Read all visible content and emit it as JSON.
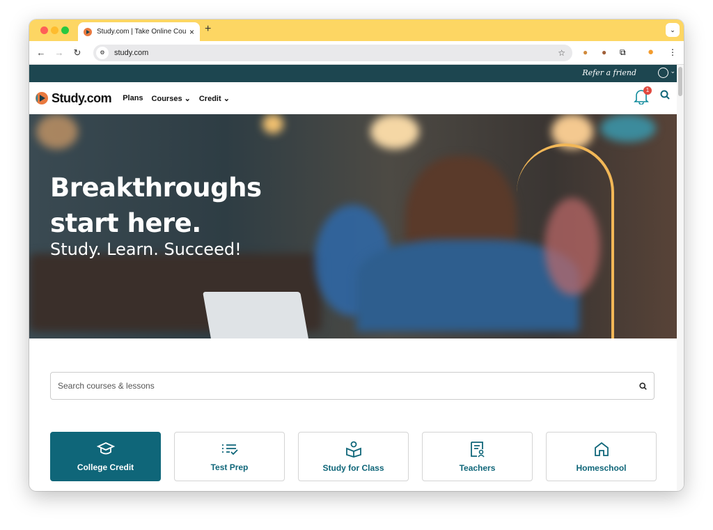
{
  "browser": {
    "tab_title": "Study.com | Take Online Courses",
    "url": "study.com",
    "new_tab": "+",
    "close": "×"
  },
  "site": {
    "refer": "Refer a friend",
    "brand": "Study.com",
    "nav": [
      "Plans",
      "Courses",
      "Credit"
    ],
    "notification_count": "1"
  },
  "hero": {
    "line1": "Breakthroughs",
    "line2": "start here.",
    "tagline": "Study. Learn. Succeed!"
  },
  "search": {
    "placeholder": "Search courses & lessons"
  },
  "tiles": [
    {
      "label": "College Credit",
      "icon": "graduation-cap-icon",
      "active": true
    },
    {
      "label": "Test Prep",
      "icon": "checklist-icon"
    },
    {
      "label": "Study for Class",
      "icon": "reader-book-icon"
    },
    {
      "label": "Teachers",
      "icon": "teacher-doc-icon"
    },
    {
      "label": "Homeschool",
      "icon": "home-icon"
    }
  ],
  "colors": {
    "accent": "#0f6679",
    "topstrip": "#1d4650",
    "tabbar": "#fdd663",
    "arc": "#f2b757"
  }
}
